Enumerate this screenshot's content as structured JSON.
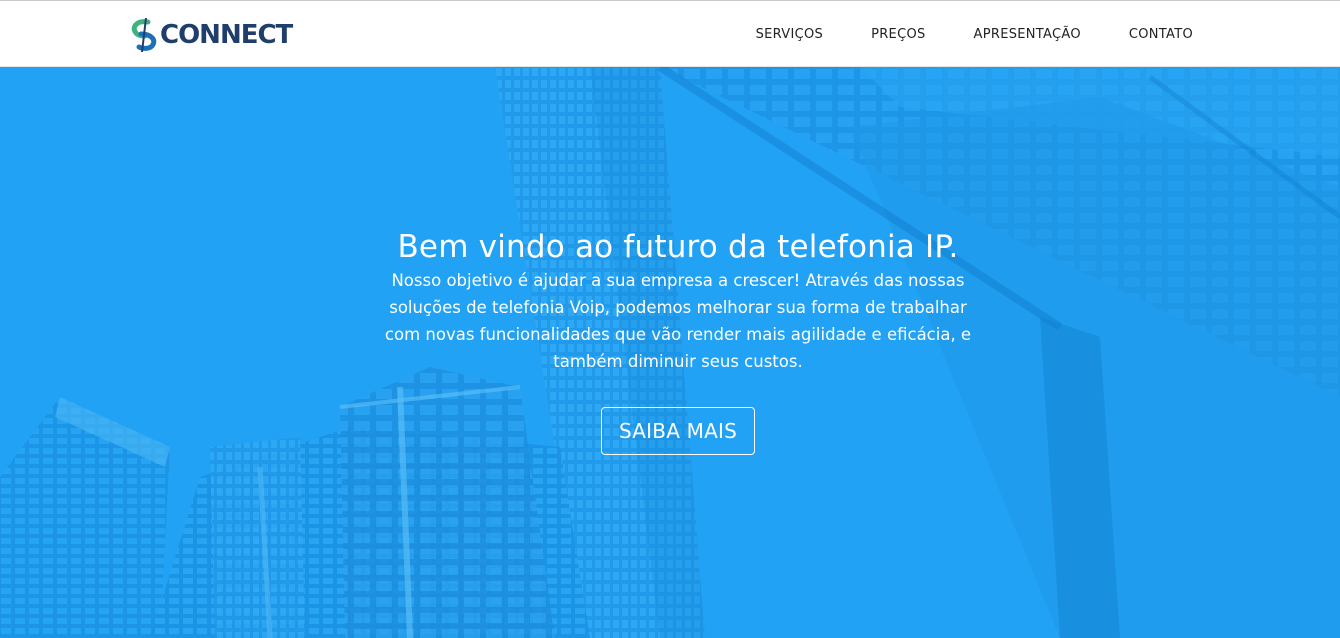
{
  "brand": {
    "name": "CONNECT",
    "logo_icon": "connect-swirl-logo",
    "colors": {
      "text": "#203e6b",
      "green": "#3fb27f",
      "blue": "#1d6fb8"
    }
  },
  "nav": {
    "items": [
      {
        "label": "SERVIÇOS"
      },
      {
        "label": "PREÇOS"
      },
      {
        "label": "APRESENTAÇÃO"
      },
      {
        "label": "CONTATO"
      }
    ]
  },
  "hero": {
    "title": "Bem vindo ao futuro da telefonia IP.",
    "lines": [
      "Nosso objetivo é ajudar a sua empresa a crescer! Através das nossas",
      "soluções  de telefonia Voip, podemos melhorar sua forma de trabalhar",
      "com novas funcionalidades que vão render mais agilidade e eficácia, e",
      "também diminuir seus custos."
    ],
    "cta_label": "SAIBA MAIS",
    "background_image": "skyscrapers-blue-tint",
    "colors": {
      "overlay": "#22a3f6",
      "text": "#ffffff"
    }
  }
}
